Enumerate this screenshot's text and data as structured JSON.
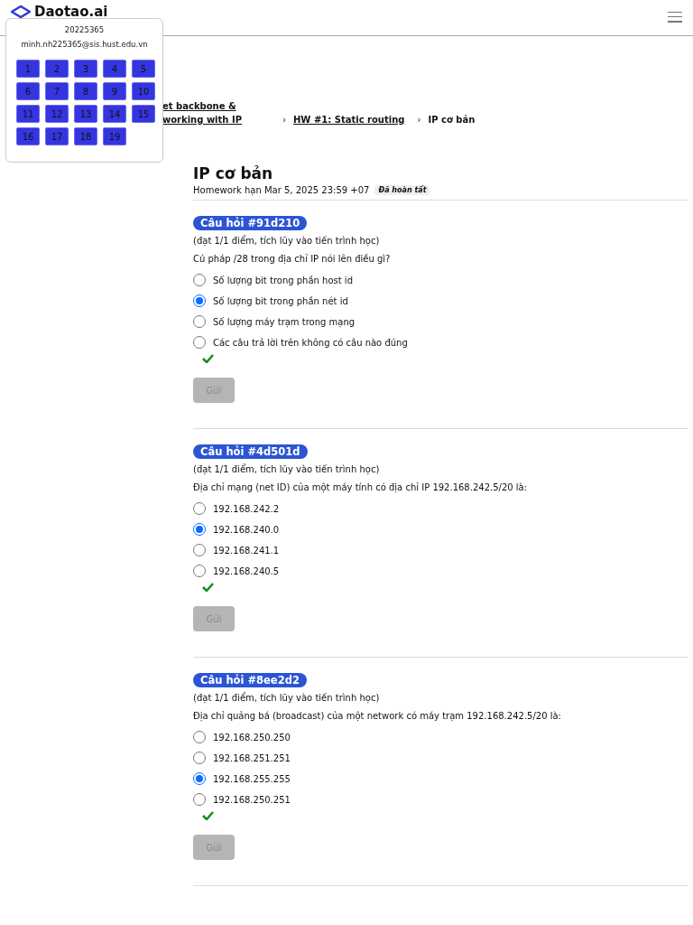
{
  "header": {
    "logo_text": "Daotao.ai"
  },
  "popover": {
    "student_id": "20225365",
    "email": "minh.nh225365@sis.hust.edu.vn",
    "question_numbers": [
      "1",
      "2",
      "3",
      "4",
      "5",
      "6",
      "7",
      "8",
      "9",
      "10",
      "11",
      "12",
      "13",
      "14",
      "15",
      "16",
      "17",
      "18",
      "19"
    ]
  },
  "breadcrumb": [
    {
      "label": "et backbone & working with IP",
      "current": false
    },
    {
      "separator": "›",
      "label": "HW #1: Static routing",
      "current": false
    },
    {
      "separator": "›",
      "label": "IP cơ bản",
      "current": true
    }
  ],
  "page": {
    "title": "IP cơ bản",
    "subtitle": "Homework hạn Mar 5, 2025 23:59 +07",
    "status": "Đã hoàn tất"
  },
  "questions": [
    {
      "badge": "Câu hỏi #91d210",
      "score": "(đạt 1/1 điểm, tích lũy vào tiến trình học)",
      "prompt": "Cú pháp /28 trong địa chỉ IP nói lên điều gì?",
      "correct": true,
      "submit": {
        "label": "Gửi",
        "disabled": true
      },
      "options": [
        {
          "label": "Số lượng bit trong phần host id",
          "selected": false
        },
        {
          "label": "Số lượng bit trong phần nét id",
          "selected": true
        },
        {
          "label": "Số lượng máy trạm trong mạng",
          "selected": false
        },
        {
          "label": "Các câu trả lời trên không có câu nào đúng",
          "selected": false
        }
      ]
    },
    {
      "badge": "Câu hỏi #4d501d",
      "score": "(đạt 1/1 điểm, tích lũy vào tiến trình học)",
      "prompt": "Địa chỉ mạng (net ID) của một máy tính có địa chỉ IP 192.168.242.5/20 là:",
      "correct": true,
      "submit": {
        "label": "Gửi",
        "disabled": true
      },
      "options": [
        {
          "label": "192.168.242.2",
          "selected": false
        },
        {
          "label": "192.168.240.0",
          "selected": true
        },
        {
          "label": "192.168.241.1",
          "selected": false
        },
        {
          "label": "192.168.240.5",
          "selected": false
        }
      ]
    },
    {
      "badge": "Câu hỏi #8ee2d2",
      "score": "(đạt 1/1 điểm, tích lũy vào tiến trình học)",
      "prompt": "Địa chỉ quảng bá (broadcast) của một network có máy trạm 192.168.242.5/20 là:",
      "correct": true,
      "submit": {
        "label": "Gửi",
        "disabled": true
      },
      "options": [
        {
          "label": "192.168.250.250",
          "selected": false
        },
        {
          "label": "192.168.251.251",
          "selected": false
        },
        {
          "label": "192.168.255.255",
          "selected": true
        },
        {
          "label": "192.168.250.251",
          "selected": false
        }
      ]
    }
  ]
}
